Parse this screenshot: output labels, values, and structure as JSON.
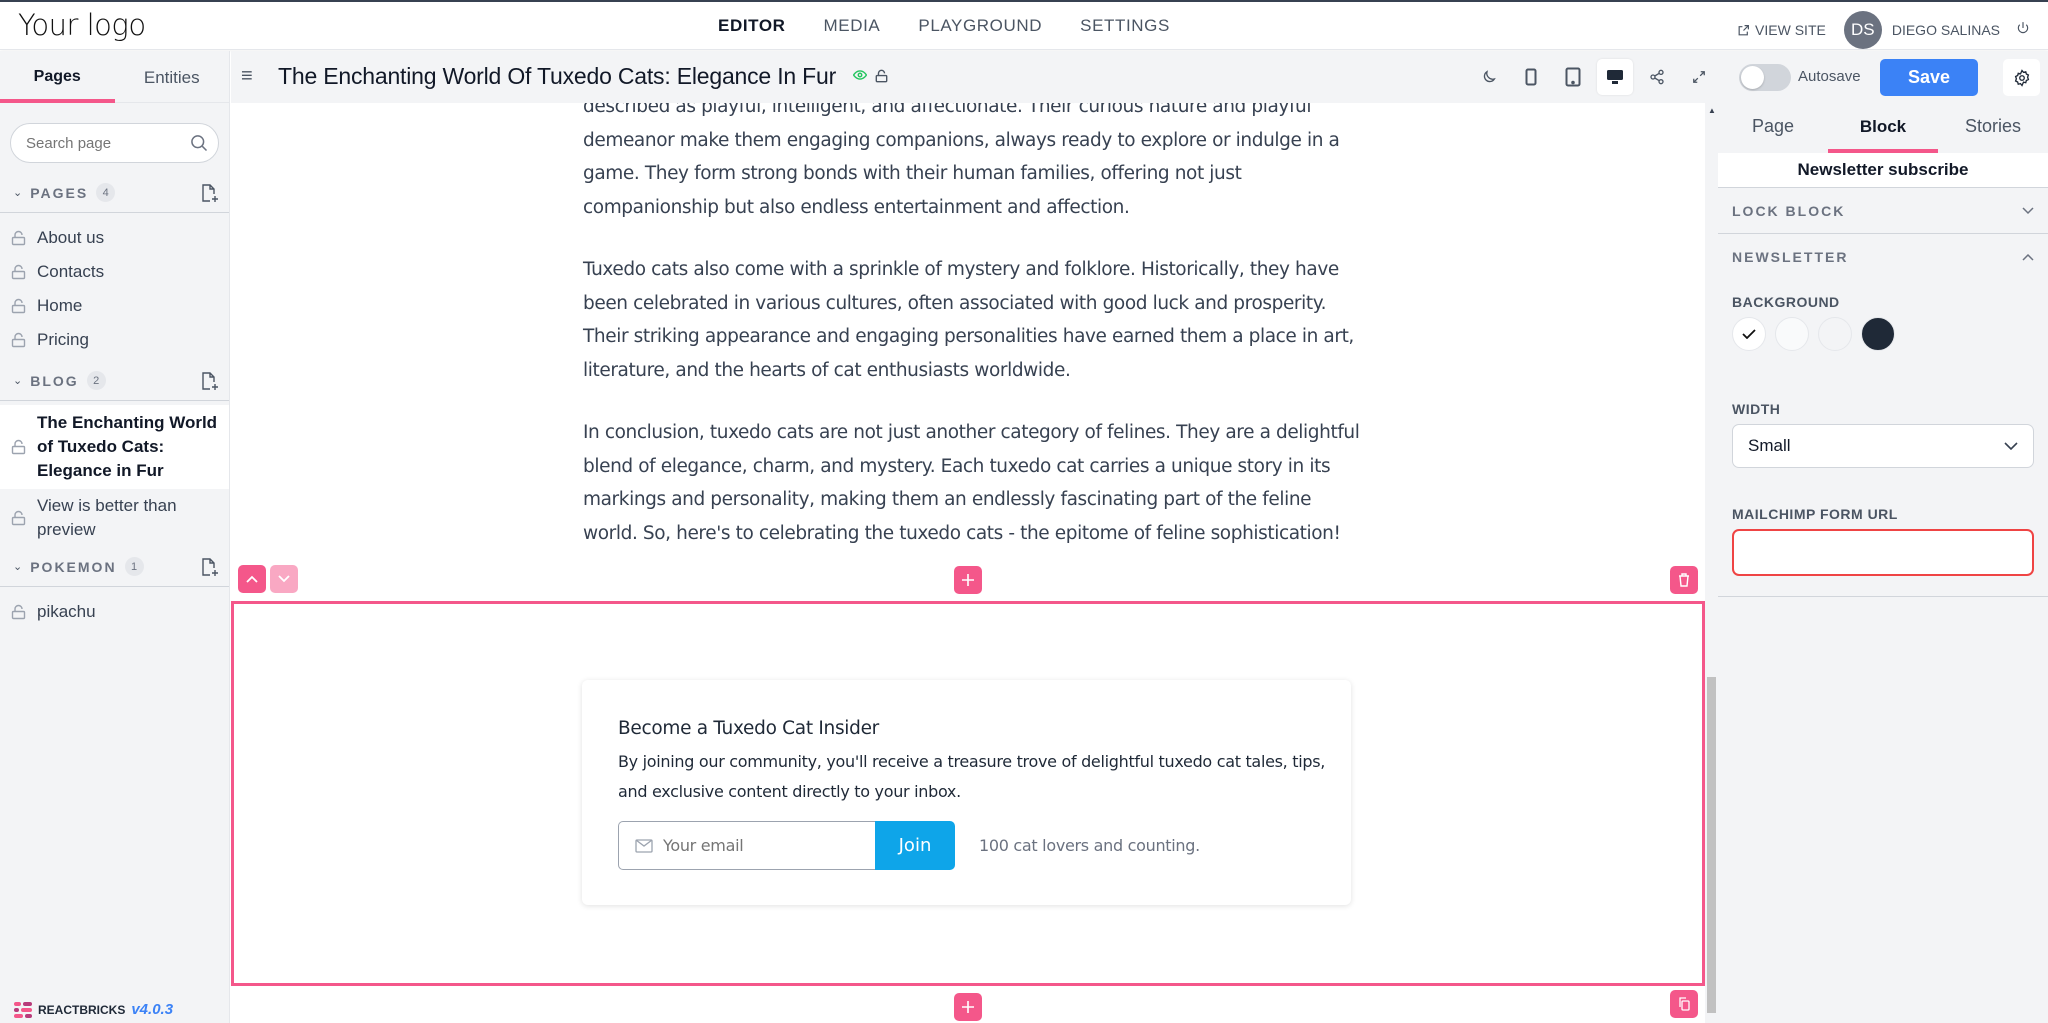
{
  "topbar": {
    "logo": "Your logo",
    "nav": [
      {
        "label": "EDITOR",
        "active": true
      },
      {
        "label": "MEDIA",
        "active": false
      },
      {
        "label": "PLAYGROUND",
        "active": false
      },
      {
        "label": "SETTINGS",
        "active": false
      }
    ],
    "view_site": "VIEW SITE",
    "avatar_initials": "DS",
    "user_name": "DIEGO SALINAS"
  },
  "sidebar": {
    "tabs": [
      {
        "label": "Pages",
        "active": true
      },
      {
        "label": "Entities",
        "active": false
      }
    ],
    "search_placeholder": "Search page",
    "sections": [
      {
        "title": "PAGES",
        "count": "4",
        "items": [
          "About us",
          "Contacts",
          "Home",
          "Pricing"
        ]
      },
      {
        "title": "BLOG",
        "count": "2",
        "items": [
          "The Enchanting World of Tuxedo Cats: Elegance in Fur",
          "View is better than preview"
        ],
        "selected": 0
      },
      {
        "title": "POKEMON",
        "count": "1",
        "items": [
          "pikachu"
        ]
      }
    ],
    "brand": "REACTBRICKS",
    "version": "v4.0.3"
  },
  "toolbar": {
    "page_title": "The Enchanting World Of Tuxedo Cats: Elegance In Fur",
    "active_device": "desktop",
    "autosave_label": "Autosave",
    "autosave_on": false,
    "save_label": "Save"
  },
  "content": {
    "paragraphs": [
      "described as playful, intelligent, and affectionate. Their curious nature and playful demeanor make them engaging companions, always ready to explore or indulge in a game. They form strong bonds with their human families, offering not just companionship but also endless entertainment and affection.",
      "Tuxedo cats also come with a sprinkle of mystery and folklore. Historically, they have been celebrated in various cultures, often associated with good luck and prosperity. Their striking appearance and engaging personalities have earned them a place in art, literature, and the hearts of cat enthusiasts worldwide.",
      "In conclusion, tuxedo cats are not just another category of felines. They are a delightful blend of elegance, charm, and mystery. Each tuxedo cat carries a unique story in its markings and personality, making them an endlessly fascinating part of the feline world. So, here's to celebrating the tuxedo cats - the epitome of feline sophistication!"
    ],
    "newsletter": {
      "title": "Become a Tuxedo Cat Insider",
      "description": "By joining our community, you'll receive a treasure trove of delightful tuxedo cat tales, tips, and exclusive content directly to your inbox.",
      "email_placeholder": "Your email",
      "join_label": "Join",
      "count_text": "100 cat lovers and counting."
    }
  },
  "rightpanel": {
    "tabs": [
      {
        "label": "Page",
        "active": false
      },
      {
        "label": "Block",
        "active": true
      },
      {
        "label": "Stories",
        "active": false
      }
    ],
    "block_name": "Newsletter subscribe",
    "lock_block": "LOCK BLOCK",
    "newsletter_section": "NEWSLETTER",
    "background_label": "BACKGROUND",
    "background_colors": [
      "#ffffff",
      "#f9fafb",
      "#f3f4f6",
      "#1f2937"
    ],
    "background_selected": 0,
    "width_label": "WIDTH",
    "width_value": "Small",
    "mailchimp_label": "MAILCHIMP FORM URL",
    "mailchimp_value": ""
  },
  "colors": {
    "accent": "#f4578a",
    "primary": "#3b82f6",
    "join": "#0ea5e9",
    "error": "#ef4444"
  }
}
